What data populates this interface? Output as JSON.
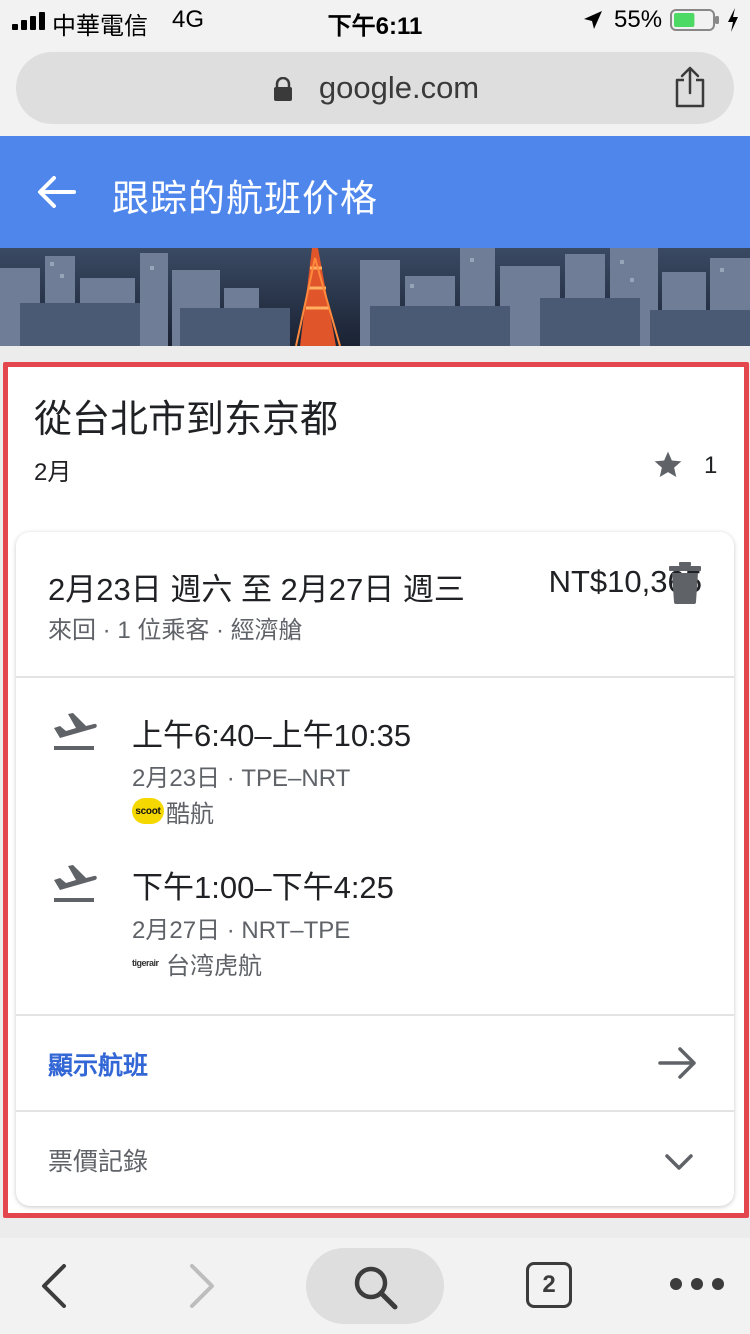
{
  "status_bar": {
    "carrier": "中華電信",
    "network": "4G",
    "time": "下午6:11",
    "battery": "55%",
    "battery_level": 0.55
  },
  "browser": {
    "url": "google.com"
  },
  "header": {
    "title": "跟踪的航班价格"
  },
  "tracked": {
    "route_title": "從台北市到东京都",
    "month": "2月",
    "star_count": "1",
    "trip": {
      "dates": "2月23日 週六 至 2月27日 週三",
      "price": "NT$10,365",
      "meta": "來回 · 1 位乘客 · 經濟艙",
      "flights": [
        {
          "times": "上午6:40–上午10:35",
          "date_route": "2月23日 · TPE–NRT",
          "airline_logo": "scoot",
          "airline": "酷航",
          "icon": "plane-departure-icon"
        },
        {
          "times": "下午1:00–下午4:25",
          "date_route": "2月27日 · NRT–TPE",
          "airline_logo": "tigerair",
          "airline": "台湾虎航",
          "icon": "plane-departure-icon"
        }
      ],
      "show_flights": "顯示航班",
      "price_history": "票價記錄"
    }
  },
  "toolbar": {
    "tab_count": "2"
  },
  "colors": {
    "header_bg": "#4f86ec",
    "link": "#3367d6",
    "highlight": "#e3464d",
    "battery": "#4cd964"
  }
}
